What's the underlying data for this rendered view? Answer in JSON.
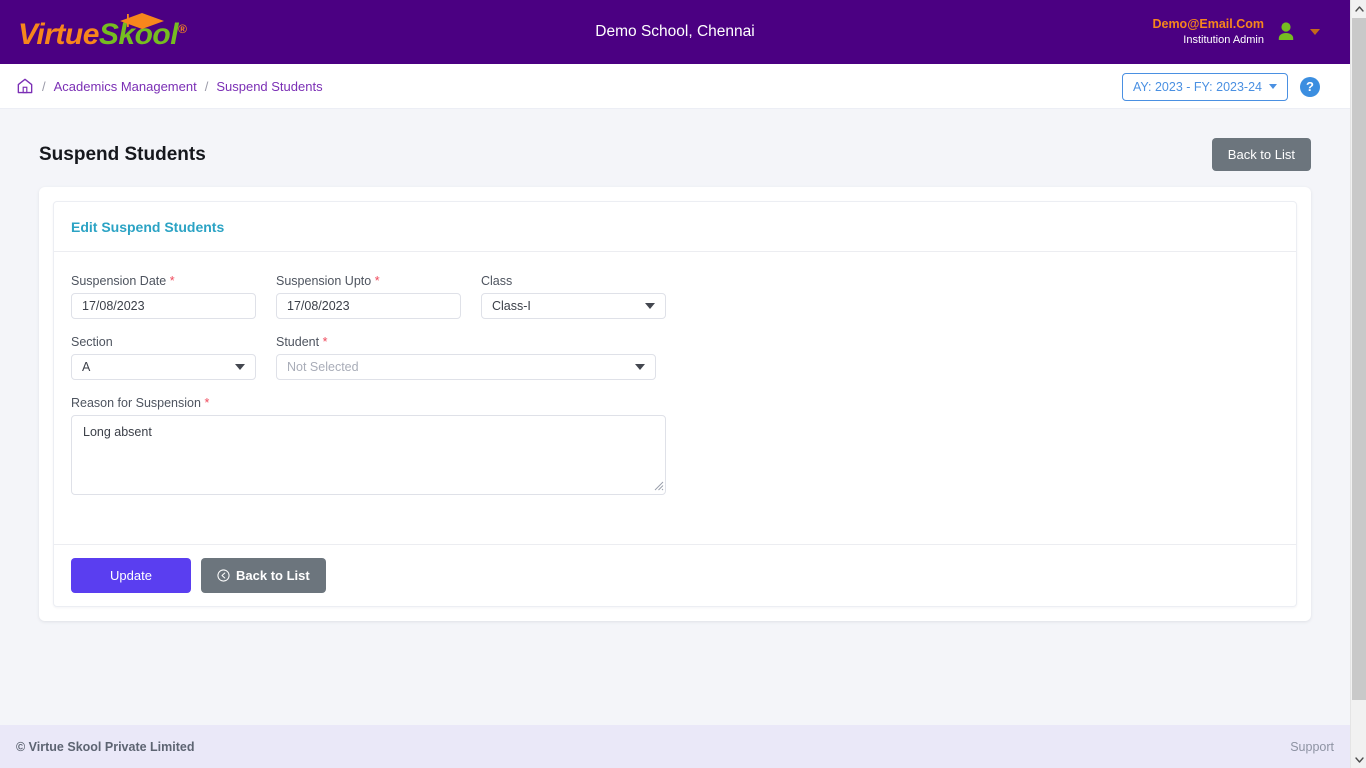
{
  "header": {
    "brand": {
      "part1": "Virtue",
      "part2": "Skool",
      "registered": "®",
      "cap_icon": "graduation-cap-icon"
    },
    "school_title": "Demo School, Chennai",
    "user": {
      "email": "Demo@Email.Com",
      "role": "Institution Admin",
      "avatar_icon": "user-avatar-icon",
      "caret_icon": "chevron-down-icon"
    }
  },
  "breadcrumb": {
    "home_icon": "home-icon",
    "separator": "/",
    "items": [
      {
        "label": "Academics Management"
      },
      {
        "label": "Suspend Students"
      }
    ],
    "academic_year_selector": {
      "value": "AY: 2023 - FY: 2023-24",
      "caret_icon": "chevron-down-icon"
    },
    "help_button": {
      "label": "?",
      "icon": "question-mark-icon"
    }
  },
  "page": {
    "title": "Suspend Students",
    "back_to_list_top": "Back to List"
  },
  "card": {
    "title": "Edit Suspend Students",
    "fields": {
      "suspension_date": {
        "label": "Suspension Date",
        "required": true,
        "value": "17/08/2023"
      },
      "suspension_upto": {
        "label": "Suspension Upto",
        "required": true,
        "value": "17/08/2023"
      },
      "class": {
        "label": "Class",
        "required": false,
        "value": "Class-I"
      },
      "section": {
        "label": "Section",
        "required": false,
        "value": "A"
      },
      "student": {
        "label": "Student",
        "required": true,
        "value": "",
        "placeholder": "Not Selected"
      },
      "reason": {
        "label": "Reason for Suspension",
        "required": true,
        "value": "Long absent"
      }
    },
    "actions": {
      "update": "Update",
      "back_to_list": "Back to List",
      "back_icon": "arrow-left-circle-icon"
    }
  },
  "footer": {
    "copyright": "© Virtue Skool Private Limited",
    "support": "Support"
  },
  "colors": {
    "header_purple": "#4b0082",
    "brand_orange": "#f7861c",
    "brand_green": "#76bc21",
    "breadcrumb_purple": "#7b2fb5",
    "accent_blue": "#4a90e2",
    "card_title_teal": "#2ba3c4",
    "primary_button": "#5a3ef0",
    "gray_button": "#6c757d",
    "required_red": "#ef4a5c",
    "footer_bg": "#eae8f8",
    "page_bg": "#f4f5f9"
  },
  "scrollbar": {
    "up_arrow": "chevron-up-icon",
    "down_arrow": "chevron-down-icon"
  }
}
